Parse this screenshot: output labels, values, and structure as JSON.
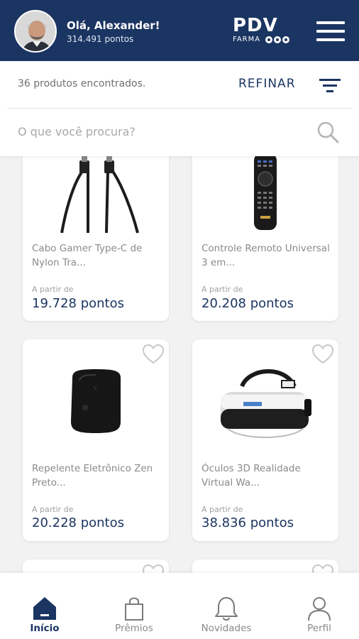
{
  "header": {
    "greeting": "Olá, Alexander!",
    "points": "314.491 pontos",
    "logo_main": "PDV",
    "logo_sub": "FARMA",
    "brand_color": "#1b3562"
  },
  "filters": {
    "results_text": "36 produtos encontrados.",
    "refine_label": "REFINAR",
    "search_placeholder": "O que você procura?",
    "search_value": ""
  },
  "products": [
    {
      "name": "Cabo Gamer Type-C de Nylon Tra...",
      "from_label": "A partir de",
      "price": "19.728 pontos",
      "image": "cable-image"
    },
    {
      "name": "Controle Remoto Universal 3 em...",
      "from_label": "A partir de",
      "price": "20.208 pontos",
      "image": "remote-image"
    },
    {
      "name": "Repelente Eletrônico Zen Preto...",
      "from_label": "A partir de",
      "price": "20.228 pontos",
      "image": "repellent-image"
    },
    {
      "name": "Óculos 3D Realidade Virtual Wa...",
      "from_label": "A partir de",
      "price": "38.836 pontos",
      "image": "vr-headset-image"
    }
  ],
  "bottom_nav": {
    "items": [
      {
        "label": "Início",
        "icon": "home-icon",
        "active": true
      },
      {
        "label": "Prêmios",
        "icon": "shopping-bag-icon",
        "active": false
      },
      {
        "label": "Novidades",
        "icon": "bell-icon",
        "active": false
      },
      {
        "label": "Perfil",
        "icon": "person-icon",
        "active": false
      }
    ]
  }
}
